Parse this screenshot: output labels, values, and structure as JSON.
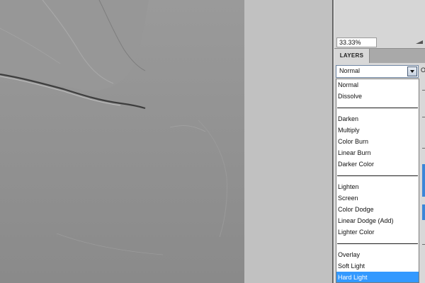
{
  "zoom": {
    "value": "33.33%",
    "slider_icon": "zoom-slider-icon"
  },
  "layers_panel": {
    "tab_label": "LAYERS",
    "blend_mode_value": "Normal",
    "opacity_label": "O"
  },
  "blend_menu": {
    "groups": [
      [
        "Normal",
        "Dissolve"
      ],
      [
        "Darken",
        "Multiply",
        "Color Burn",
        "Linear Burn",
        "Darker Color"
      ],
      [
        "Lighten",
        "Screen",
        "Color Dodge",
        "Linear Dodge (Add)",
        "Lighter Color"
      ],
      [
        "Overlay",
        "Soft Light",
        "Hard Light"
      ]
    ],
    "selected": "Hard Light"
  },
  "colors": {
    "selection": "#3399ff",
    "canvas_gray": "#8d8d8d"
  }
}
